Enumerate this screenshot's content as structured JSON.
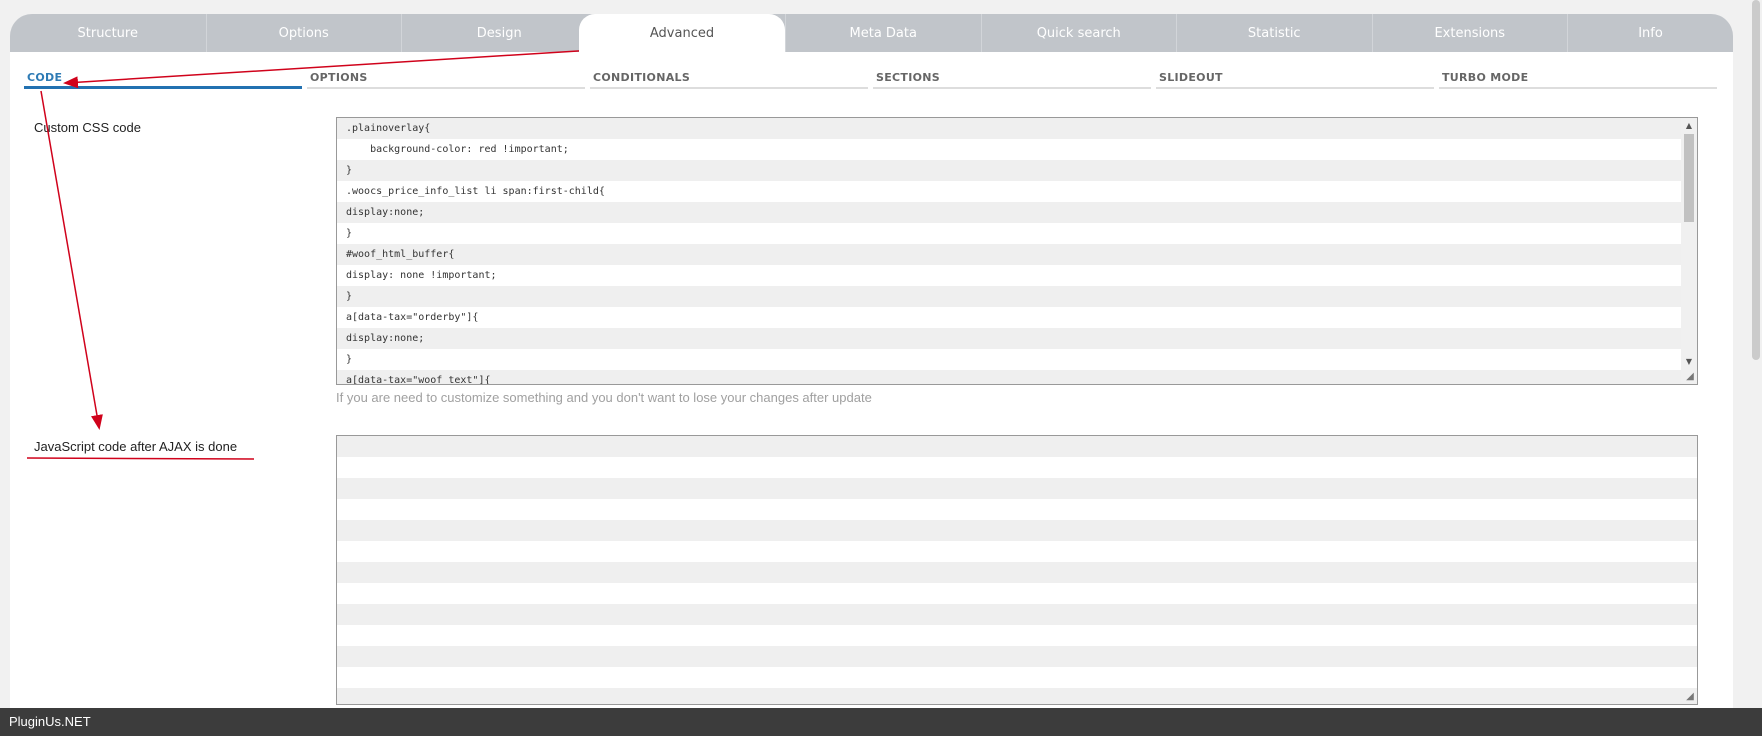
{
  "tabs": [
    {
      "label": "Structure"
    },
    {
      "label": "Options"
    },
    {
      "label": "Design"
    },
    {
      "label": "Advanced"
    },
    {
      "label": "Meta Data"
    },
    {
      "label": "Quick search"
    },
    {
      "label": "Statistic"
    },
    {
      "label": "Extensions"
    },
    {
      "label": "Info"
    }
  ],
  "active_tab": "Advanced",
  "subtabs": [
    {
      "label": "CODE"
    },
    {
      "label": "OPTIONS"
    },
    {
      "label": "CONDITIONALS"
    },
    {
      "label": "SECTIONS"
    },
    {
      "label": "SLIDEOUT"
    },
    {
      "label": "TURBO MODE"
    }
  ],
  "active_subtab": "CODE",
  "css_section": {
    "label": "Custom CSS code",
    "code_lines": [
      ".plainoverlay{",
      "    background-color: red !important;",
      "}",
      ".woocs_price_info_list li span:first-child{",
      "display:none;",
      "}",
      "#woof_html_buffer{",
      "display: none !important;",
      "}",
      "a[data-tax=\"orderby\"]{",
      "display:none;",
      "}",
      "a[data-tax=\"woof_text\"]{"
    ],
    "hint": "If you are need to customize something and you don't want to lose your changes after update"
  },
  "js_section": {
    "label": "JavaScript code after AJAX is done"
  },
  "footer": {
    "text": "PluginUs.NET"
  },
  "colors": {
    "tabbar": "#c1c5ca",
    "active_subtab": "#2271b1",
    "annotation": "#d0021b",
    "footer_bg": "#3c3c3c"
  }
}
